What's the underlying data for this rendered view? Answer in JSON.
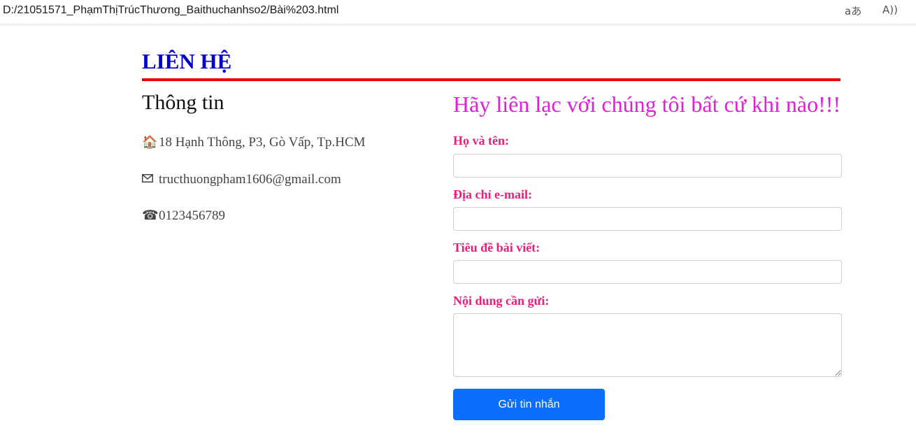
{
  "browser": {
    "url": "D:/21051571_PhạmThịTrúcThương_Baithuchanhso2/Bài%203.html",
    "translate_icon": "aあ",
    "read_aloud_icon": "A))"
  },
  "page": {
    "title": "LIÊN HỆ"
  },
  "info": {
    "heading": "Thông tin",
    "address": "18 Hạnh Thông, P3, Gò Vấp, Tp.HCM",
    "email": "tructhuongpham1606@gmail.com",
    "phone": "0123456789",
    "icons": {
      "address": "house-icon",
      "email": "envelope-icon",
      "phone": "telephone-icon"
    }
  },
  "form": {
    "heading": "Hãy liên lạc với chúng tôi bất cứ khi nào!!!",
    "name_label": "Họ và tên:",
    "email_label": "Địa chỉ e-mail:",
    "subject_label": "Tiêu đề bài viết:",
    "message_label": "Nội dung cần gửi:",
    "name_value": "",
    "email_value": "",
    "subject_value": "",
    "message_value": "",
    "submit_label": "Gửi tin nhắn"
  },
  "colors": {
    "title": "#0000cc",
    "rule": "#ee0000",
    "form_heading": "#e020d8",
    "form_label": "#e8207a",
    "button": "#0d6efd"
  }
}
